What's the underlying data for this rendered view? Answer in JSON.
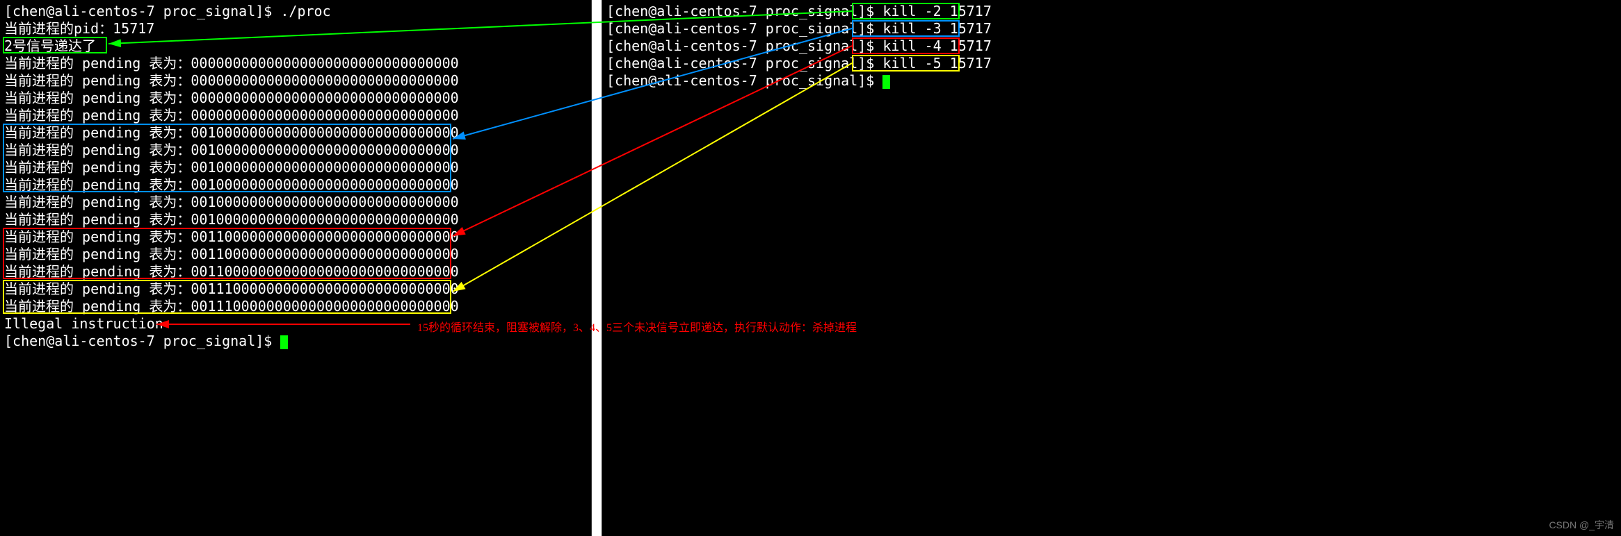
{
  "left": {
    "prompt": "[chen@ali-centos-7 proc_signal]$",
    "cmd1": "./proc",
    "pid_line": "当前进程的pid：15717",
    "signal2": "2号信号递达了",
    "pending_zero": "当前进程的 pending 表为：00000000000000000000000000000000",
    "pending_3": "当前进程的 pending 表为：00100000000000000000000000000000",
    "pending_34": "当前进程的 pending 表为：00110000000000000000000000000000",
    "pending_345": "当前进程的 pending 表为：00111000000000000000000000000000",
    "illegal": "Illegal instruction"
  },
  "right": {
    "prompt": "[chen@ali-centos-7 proc_signal]$",
    "kill2": "kill -2 15717",
    "kill3": "kill -3 15717",
    "kill4": "kill -4 15717",
    "kill5": "kill -5 15717"
  },
  "annotation": "15秒的循环结束，阻塞被解除，3、4、5三个未决信号立即递达，执行默认动作：杀掉进程",
  "watermark": "CSDN @_宇清"
}
